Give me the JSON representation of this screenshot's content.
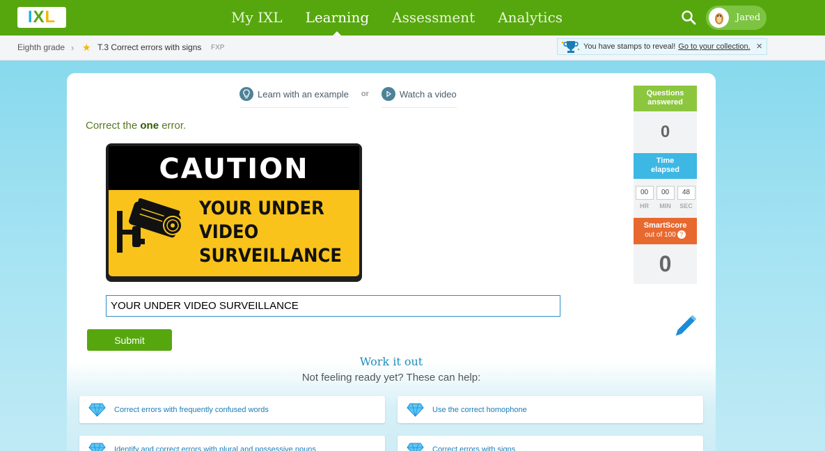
{
  "nav": {
    "items": [
      {
        "label": "My IXL",
        "active": false
      },
      {
        "label": "Learning",
        "active": true
      },
      {
        "label": "Assessment",
        "active": false
      },
      {
        "label": "Analytics",
        "active": false
      }
    ],
    "user_name": "Jared"
  },
  "breadcrumb": {
    "grade": "Eighth grade",
    "skill": "T.3 Correct errors with signs",
    "code": "FXP"
  },
  "stamps": {
    "message": "You have stamps to reveal!",
    "link": "Go to your collection."
  },
  "help": {
    "example": "Learn with an example",
    "or": "or",
    "video": "Watch a video"
  },
  "question": {
    "prompt_before": "Correct the ",
    "prompt_bold": "one",
    "prompt_after": " error.",
    "sign_header": "CAUTION",
    "sign_lines": [
      "YOUR UNDER",
      "VIDEO",
      "SURVEILLANCE"
    ],
    "answer_value": "YOUR UNDER VIDEO SURVEILLANCE",
    "submit_label": "Submit"
  },
  "stats": {
    "questions_label_1": "Questions",
    "questions_label_2": "answered",
    "questions_value": "0",
    "time_label_1": "Time",
    "time_label_2": "elapsed",
    "hr": "00",
    "min": "00",
    "sec": "48",
    "hr_label": "HR",
    "min_label": "MIN",
    "sec_label": "SEC",
    "smartscore_label": "SmartScore",
    "smartscore_sub": "out of 100",
    "smartscore_help": "?",
    "smartscore_value": "0"
  },
  "work_it_out": {
    "title": "Work it out",
    "subtitle": "Not feeling ready yet? These can help:",
    "skills": [
      "Correct errors with frequently confused words",
      "Use the correct homophone",
      "Identify and correct errors with plural and possessive nouns",
      "Correct errors with signs"
    ]
  },
  "colors": {
    "brand_green": "#56a70e",
    "accent_blue": "#3db7e4",
    "smartscore_orange": "#e8692f"
  }
}
